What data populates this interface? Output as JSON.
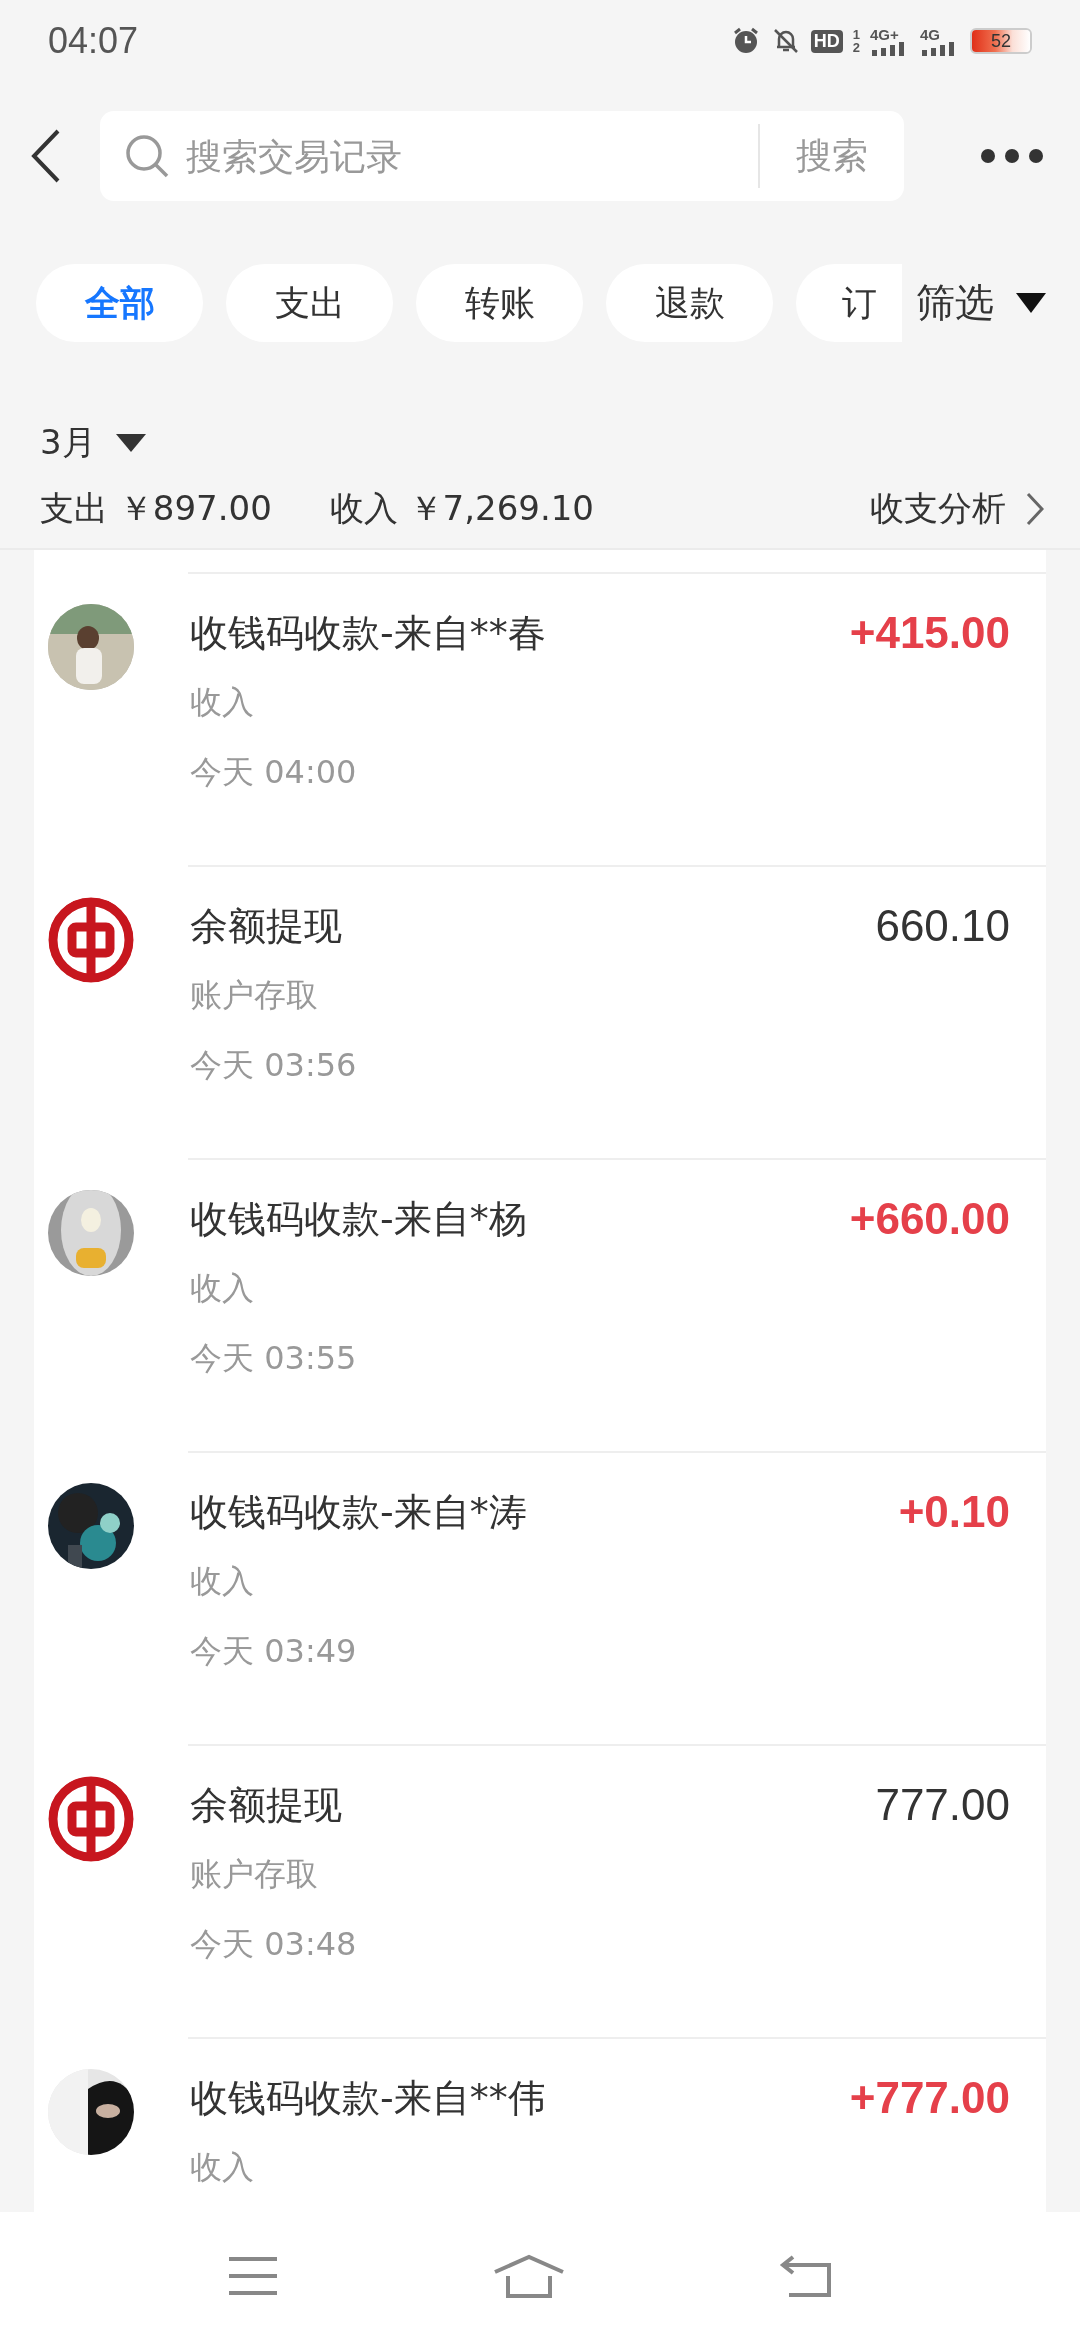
{
  "status_bar": {
    "time": "04:07",
    "hd": {
      "label": "HD",
      "sims": [
        "1",
        "2"
      ]
    },
    "networks": [
      "4G+",
      "4G"
    ],
    "battery": "52"
  },
  "header": {
    "search": {
      "placeholder": "搜索交易记录",
      "button": "搜索"
    }
  },
  "filters": {
    "chips": [
      {
        "label": "全部",
        "selected": true
      },
      {
        "label": "支出",
        "selected": false
      },
      {
        "label": "转账",
        "selected": false
      },
      {
        "label": "退款",
        "selected": false
      },
      {
        "label": "订",
        "selected": false
      }
    ],
    "filter_button": "筛选"
  },
  "summary": {
    "month": "3月",
    "expense": "支出 ￥897.00",
    "income": "收入 ￥7,269.10",
    "analysis": "收支分析"
  },
  "transactions": [
    {
      "kind": "income",
      "title": "收钱码收款-来自**春",
      "category": "收入",
      "time": "今天 04:00",
      "amount": "+415.00"
    },
    {
      "kind": "withdrawal",
      "title": "余额提现",
      "category": "账户存取",
      "time": "今天 03:56",
      "amount": "660.10"
    },
    {
      "kind": "income",
      "title": "收钱码收款-来自*杨",
      "category": "收入",
      "time": "今天 03:55",
      "amount": "+660.00"
    },
    {
      "kind": "income",
      "title": "收钱码收款-来自*涛",
      "category": "收入",
      "time": "今天 03:49",
      "amount": "+0.10"
    },
    {
      "kind": "withdrawal",
      "title": "余额提现",
      "category": "账户存取",
      "time": "今天 03:48",
      "amount": "777.00"
    },
    {
      "kind": "income",
      "title": "收钱码收款-来自**伟",
      "category": "收入",
      "amount": "+777.00"
    }
  ]
}
